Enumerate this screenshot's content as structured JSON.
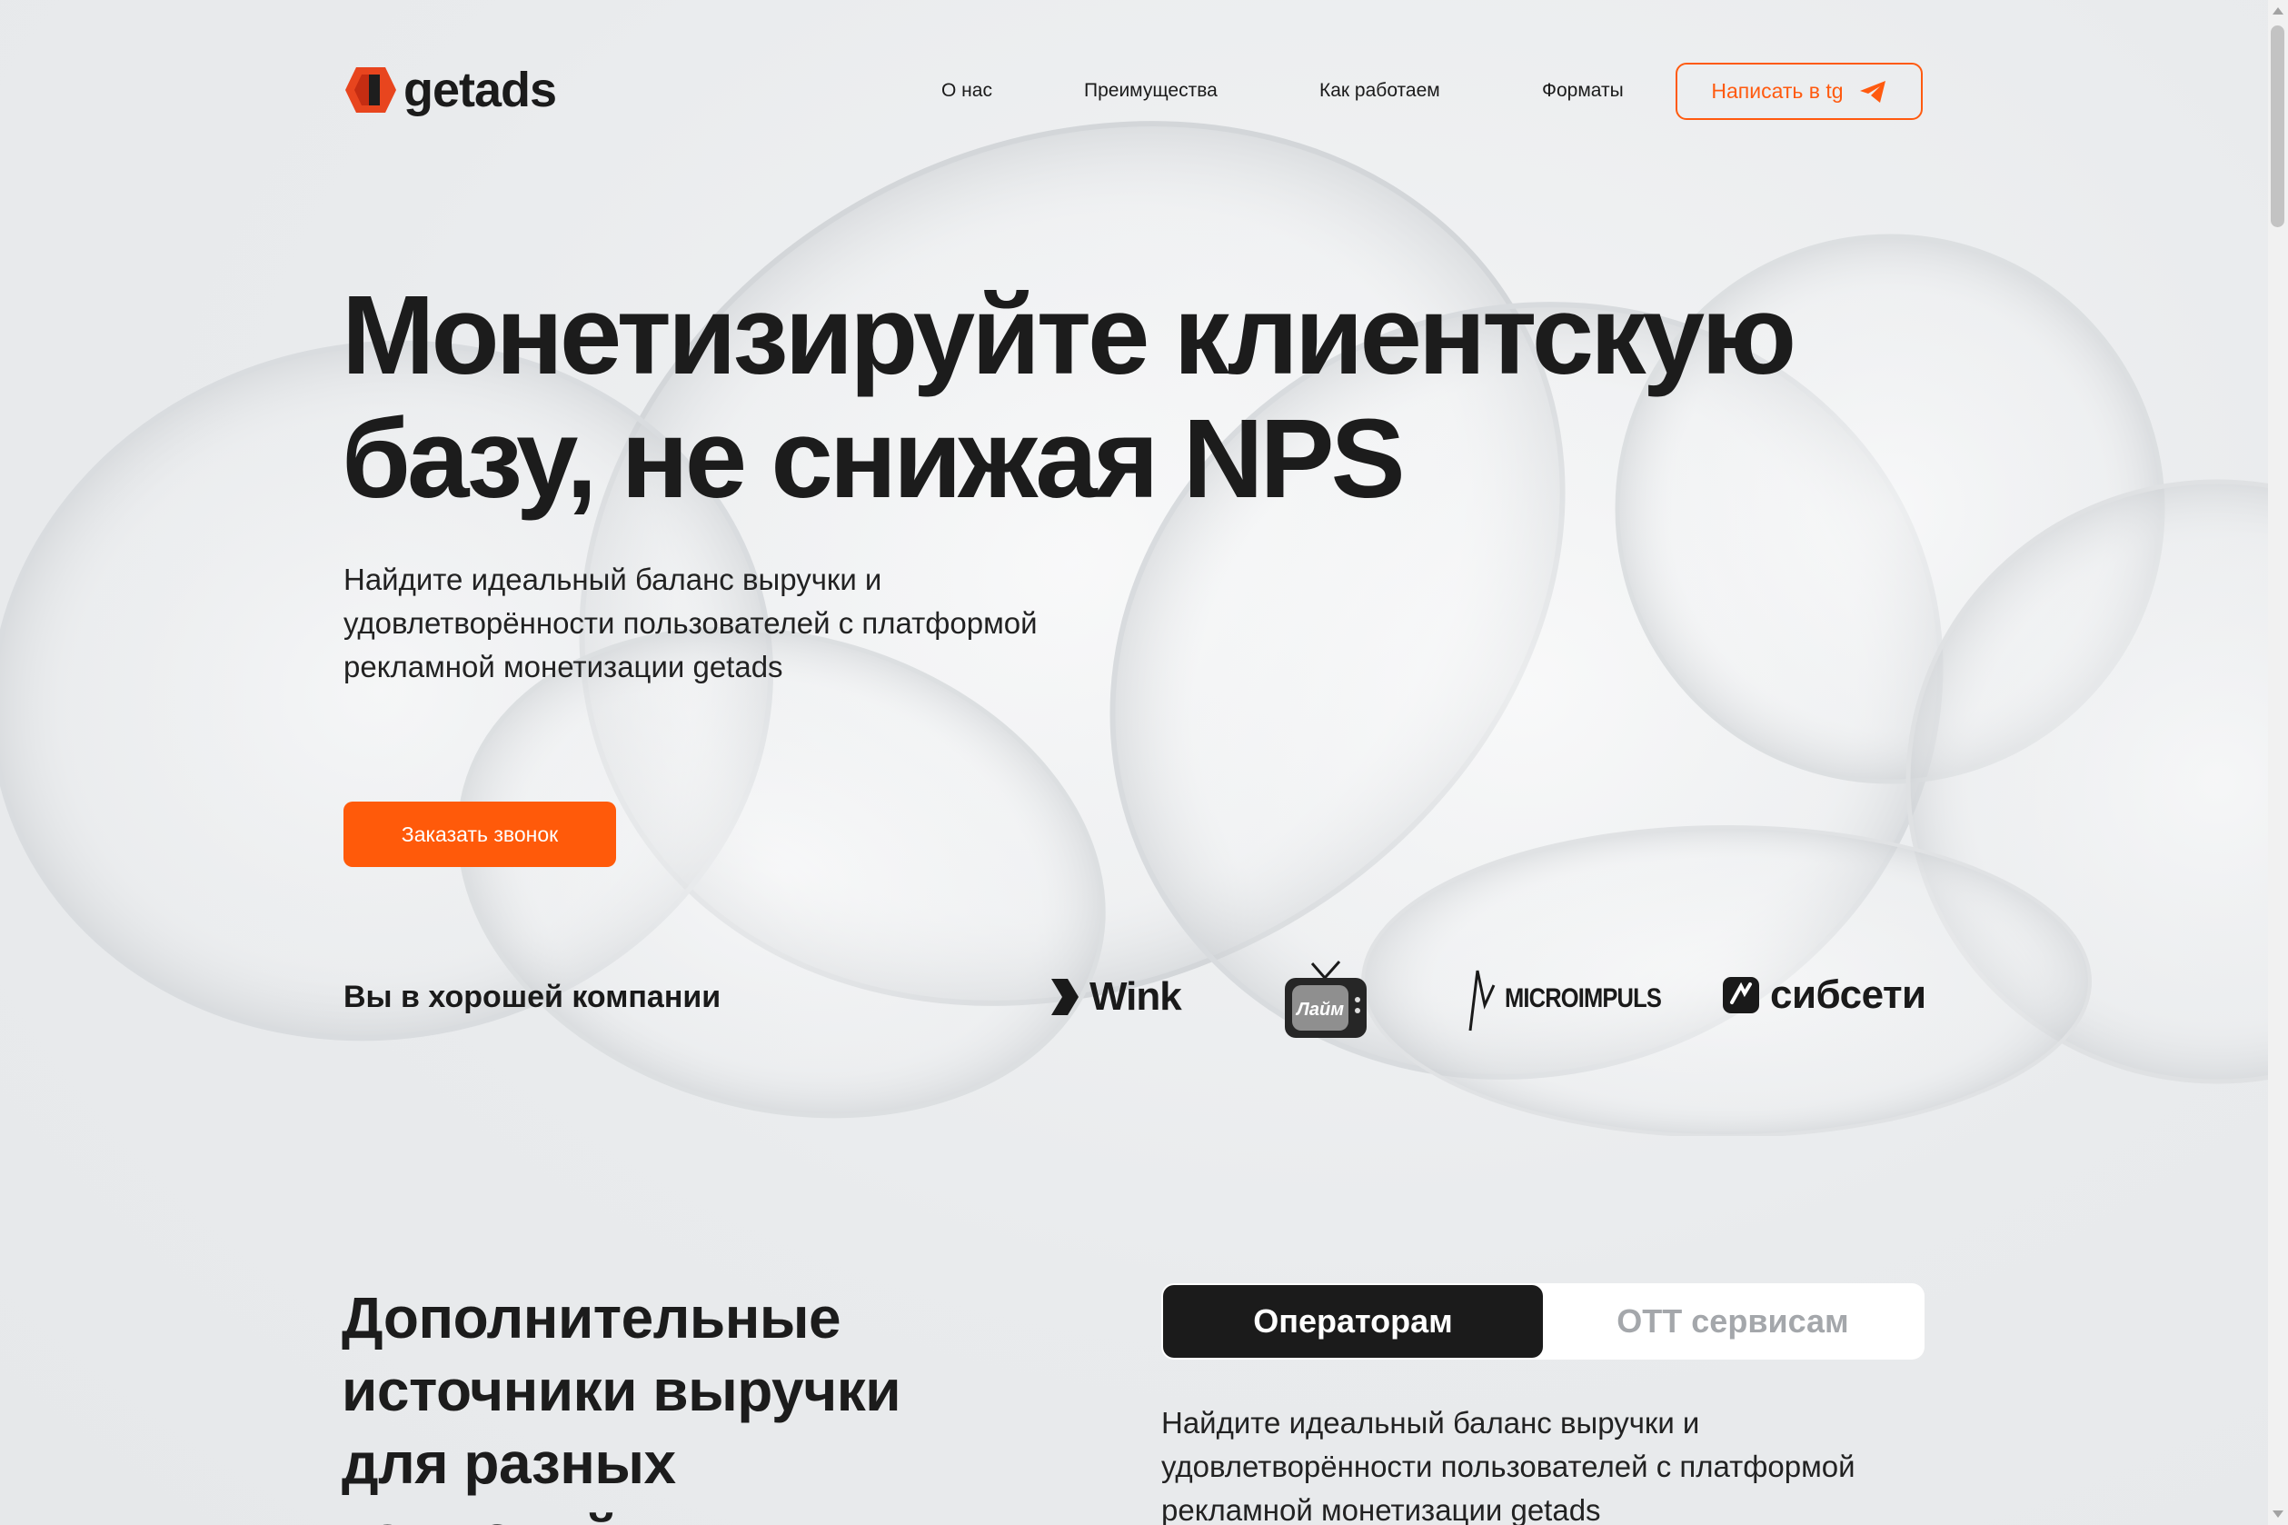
{
  "brand": {
    "name": "getads",
    "accent": "#ff5a0a",
    "logo_color": "#e8451e"
  },
  "nav": {
    "items": [
      "О нас",
      "Преимущества",
      "Как работаем",
      "Форматы"
    ],
    "cta_label": "Написать в tg"
  },
  "hero": {
    "title_line1": "Монетизируйте клиентскую",
    "title_line2": "базу, не снижая NPS",
    "subtitle": "Найдите идеальный баланс выручки и удовлетворённости пользователей с платформой рекламной монетизации getads",
    "cta_label": "Заказать звонок"
  },
  "partners": {
    "title": "Вы в хорошей компании",
    "logos": [
      {
        "name": "Wink",
        "icon": "wink-logo"
      },
      {
        "name": "Лайм",
        "icon": "laim-tv-logo"
      },
      {
        "name": "MICROIMPULS",
        "icon": "microimpuls-logo"
      },
      {
        "name": "сибсети",
        "icon": "sibseti-logo"
      }
    ]
  },
  "section": {
    "title_line1": "Дополнительные",
    "title_line2": "источники выручки",
    "title_line3": "для разных",
    "title_line4": "компаний",
    "tabs": [
      "Операторам",
      "OTT сервисам"
    ],
    "active_tab": "Операторам",
    "description": "Найдите идеальный баланс выручки и удовлетворённости пользователей с платформой рекламной монетизации getads"
  }
}
